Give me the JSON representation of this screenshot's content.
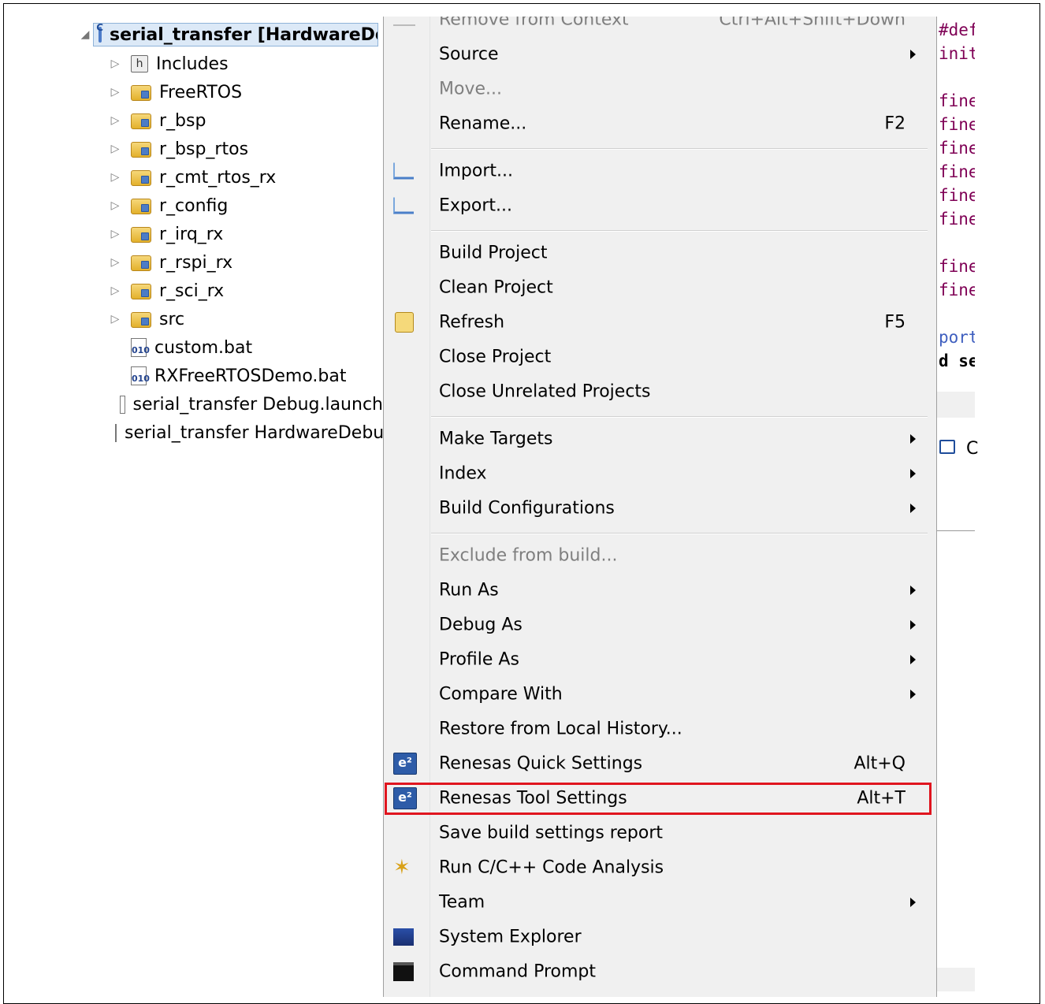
{
  "project_tree": {
    "root_label": "serial_transfer [HardwareDebug]",
    "items": [
      {
        "label": "Includes",
        "icon": "includes-icon",
        "expandable": true
      },
      {
        "label": "FreeRTOS",
        "icon": "package-folder-icon",
        "expandable": true
      },
      {
        "label": "r_bsp",
        "icon": "package-folder-icon",
        "expandable": true
      },
      {
        "label": "r_bsp_rtos",
        "icon": "package-folder-icon",
        "expandable": true
      },
      {
        "label": "r_cmt_rtos_rx",
        "icon": "package-folder-icon",
        "expandable": true
      },
      {
        "label": "r_config",
        "icon": "package-folder-icon",
        "expandable": true
      },
      {
        "label": "r_irq_rx",
        "icon": "package-folder-icon",
        "expandable": true
      },
      {
        "label": "r_rspi_rx",
        "icon": "package-folder-icon",
        "expandable": true
      },
      {
        "label": "r_sci_rx",
        "icon": "package-folder-icon",
        "expandable": true
      },
      {
        "label": "src",
        "icon": "package-folder-icon",
        "expandable": true
      },
      {
        "label": "custom.bat",
        "icon": "binary-file-icon",
        "expandable": false
      },
      {
        "label": "RXFreeRTOSDemo.bat",
        "icon": "binary-file-icon",
        "expandable": false
      },
      {
        "label": "serial_transfer Debug.launch",
        "icon": "text-file-icon",
        "expandable": false
      },
      {
        "label": "serial_transfer HardwareDebug.launch",
        "icon": "text-file-icon",
        "expandable": false
      }
    ]
  },
  "context_menu": {
    "items": [
      {
        "label": "Remove from Context",
        "shortcut": "Ctrl+Alt+Shift+Down",
        "disabled": true,
        "icon": "remove-context-icon"
      },
      {
        "label": "Source",
        "submenu": true
      },
      {
        "label": "Move...",
        "disabled": true
      },
      {
        "label": "Rename...",
        "shortcut": "F2"
      },
      {
        "label": "Import...",
        "icon": "import-icon"
      },
      {
        "label": "Export...",
        "icon": "export-icon"
      },
      {
        "label": "Build Project"
      },
      {
        "label": "Clean Project"
      },
      {
        "label": "Refresh",
        "shortcut": "F5",
        "icon": "refresh-icon"
      },
      {
        "label": "Close Project"
      },
      {
        "label": "Close Unrelated Projects"
      },
      {
        "label": "Make Targets",
        "submenu": true
      },
      {
        "label": "Index",
        "submenu": true
      },
      {
        "label": "Build Configurations",
        "submenu": true
      },
      {
        "label": "Exclude from build...",
        "disabled": true
      },
      {
        "label": "Run As",
        "submenu": true
      },
      {
        "label": "Debug As",
        "submenu": true
      },
      {
        "label": "Profile As",
        "submenu": true
      },
      {
        "label": "Compare With",
        "submenu": true
      },
      {
        "label": "Restore from Local History..."
      },
      {
        "label": "Renesas Quick Settings",
        "shortcut": "Alt+Q",
        "icon": "e2-icon"
      },
      {
        "label": "Renesas Tool Settings",
        "shortcut": "Alt+T",
        "icon": "e2-icon",
        "highlighted": true
      },
      {
        "label": "Save build settings report"
      },
      {
        "label": "Run C/C++ Code Analysis",
        "icon": "code-analysis-icon"
      },
      {
        "label": "Team",
        "submenu": true
      },
      {
        "label": "System Explorer",
        "icon": "system-explorer-icon"
      },
      {
        "label": "Command Prompt",
        "icon": "command-prompt-icon"
      }
    ],
    "highlight_color": "#e0151f"
  },
  "editor": {
    "lines": [
      "#def",
      "init",
      "fine",
      "fine",
      "fine",
      "fine",
      "fine",
      "fine",
      "fine",
      "fine",
      "port",
      "d se"
    ],
    "console_tab_label": "C"
  }
}
